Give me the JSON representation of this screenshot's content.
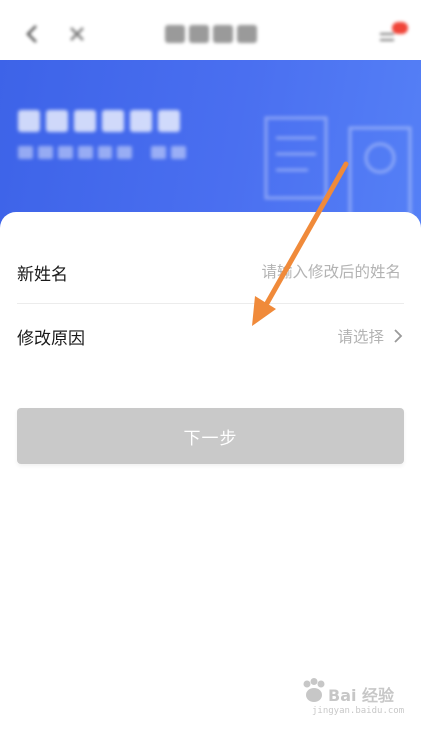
{
  "header": {
    "title": "",
    "icons": [
      "back-arrow-icon",
      "close-icon",
      "menu-icon"
    ]
  },
  "banner": {
    "title": "",
    "subtitle": ""
  },
  "form": {
    "new_name": {
      "label": "新姓名",
      "placeholder": "请输入修改后的姓名",
      "value": ""
    },
    "reason": {
      "label": "修改原因",
      "value": "请选择",
      "icon": "chevron-right-icon"
    }
  },
  "actions": {
    "next_label": "下一步"
  },
  "watermark": {
    "text": "Bai 经验",
    "sub": "jingyan.baidu.com"
  },
  "colors": {
    "banner": "#4267ec",
    "button_disabled": "#c9c9c9",
    "placeholder": "#b3b3b3",
    "arrow": "#f08a3a"
  }
}
